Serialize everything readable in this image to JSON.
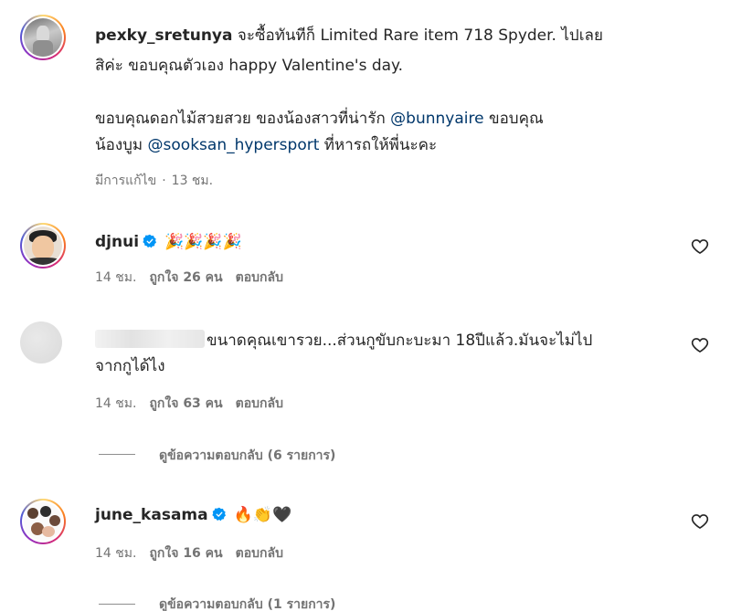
{
  "post": {
    "username": "pexky_sretunya",
    "caption_line1_a": " จะซื้อทันทีก็ Limited Rare item 718 Spyder. ",
    "caption_line1_b": "ไปเลย",
    "caption_line2_a": "สิค่ะ ขอบคุณตัวเอง ",
    "caption_line2_b": "happy Valentine's day.",
    "caption_line3_a": "ขอบคุณดอกไม้สวยสวย ของน้องสาวที่น่ารัก ",
    "mention1": "@bunnyaire",
    "caption_line3_b": " ขอบคุณ",
    "caption_line4_a": "น้องบูม ",
    "mention2": "@sooksan_hypersport",
    "caption_line4_b": " ที่หารถให้พี่นะคะ",
    "edited": "มีการแก้ไข",
    "dot": "·",
    "time": "13 ชม."
  },
  "comments": [
    {
      "username": "djnui",
      "text": "🎉🎉🎉🎉",
      "time": "14 ชม.",
      "likes": "ถูกใจ 26 คน",
      "reply": "ตอบกลับ"
    },
    {
      "text_line1": "ขนาดคุณเขารวย...ส่วนกูขับกะบะมา 18ปีแล้ว.มันจะไม่ไป",
      "text_line2": "จากกูได้ไง",
      "time": "14 ชม.",
      "likes": "ถูกใจ 63 คน",
      "reply": "ตอบกลับ",
      "view_replies": "ดูข้อความตอบกลับ (6 รายการ)"
    },
    {
      "username": "june_kasama",
      "text": "🔥👏🖤",
      "time": "14 ชม.",
      "likes": "ถูกใจ 16 คน",
      "reply": "ตอบกลับ",
      "view_replies": "ดูข้อความตอบกลับ (1 รายการ)"
    }
  ],
  "icons": {
    "verified": "verified-badge-icon",
    "like": "heart-outline-icon"
  },
  "colors": {
    "mention": "#00376b",
    "verified": "#0095f6",
    "meta": "#737373"
  }
}
